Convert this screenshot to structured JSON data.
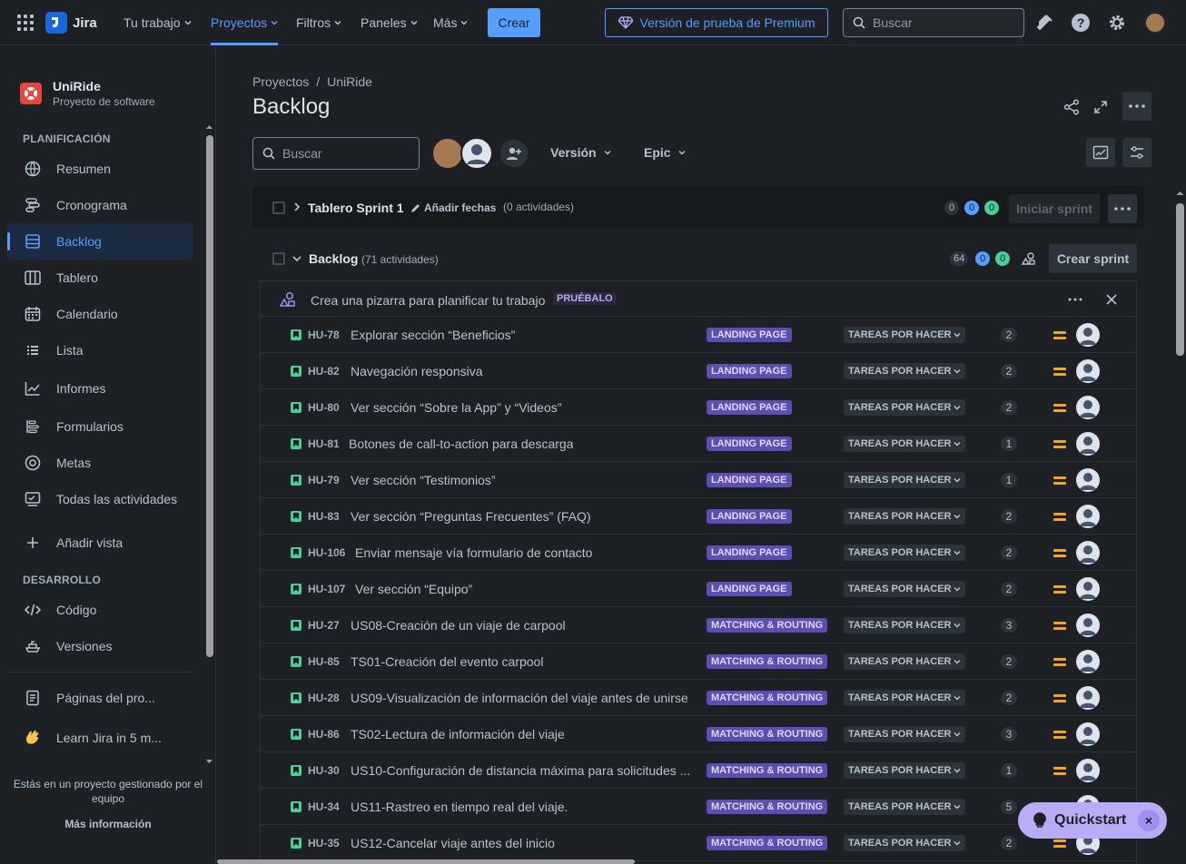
{
  "topnav": {
    "app_name": "Jira",
    "items": [
      "Tu trabajo",
      "Proyectos",
      "Filtros",
      "Paneles",
      "Más"
    ],
    "create_label": "Crear",
    "premium_label": "Versión de prueba de Premium",
    "search_placeholder": "Buscar"
  },
  "sidebar": {
    "project_name": "UniRide",
    "project_type": "Proyecto de software",
    "planning_heading": "PLANIFICACIÓN",
    "planning_items": [
      "Resumen",
      "Cronograma",
      "Backlog",
      "Tablero",
      "Calendario",
      "Lista",
      "Informes",
      "Formularios",
      "Metas",
      "Todas las actividades"
    ],
    "add_view": "Añadir vista",
    "dev_heading": "DESARROLLO",
    "dev_items": [
      "Código",
      "Versiones"
    ],
    "bottom_items": [
      "Páginas del pro...",
      "Learn Jira in 5 m..."
    ],
    "footer_text": "Estás en un proyecto gestionado por el equipo",
    "footer_link": "Más información"
  },
  "main": {
    "breadcrumb": [
      "Proyectos",
      "UniRide"
    ],
    "title": "Backlog",
    "search_placeholder": "Buscar",
    "filters": [
      "Versión",
      "Epic"
    ],
    "sprint": {
      "name": "Tablero Sprint 1",
      "add_dates": "Añadir fechas",
      "count": "(0 actividades)",
      "pills": [
        "0",
        "0",
        "0"
      ],
      "start_label": "Iniciar sprint"
    },
    "backlog": {
      "name": "Backlog",
      "count": "(71 actividades)",
      "pills": [
        "64",
        "0",
        "0"
      ],
      "create_sprint_label": "Crear sprint"
    },
    "promo": {
      "text": "Crea una pizarra para planificar tu trabajo",
      "badge": "PRUÉBALO"
    },
    "issues": [
      {
        "key": "HU-78",
        "summary": "Explorar sección “Beneficios”",
        "epic": "LANDING PAGE",
        "status": "TAREAS POR HACER",
        "estimate": "2"
      },
      {
        "key": "HU-82",
        "summary": "Navegación responsiva",
        "epic": "LANDING PAGE",
        "status": "TAREAS POR HACER",
        "estimate": "2"
      },
      {
        "key": "HU-80",
        "summary": "Ver sección “Sobre la App” y “Videos”",
        "epic": "LANDING PAGE",
        "status": "TAREAS POR HACER",
        "estimate": "2"
      },
      {
        "key": "HU-81",
        "summary": "Botones de call-to-action para descarga",
        "epic": "LANDING PAGE",
        "status": "TAREAS POR HACER",
        "estimate": "1"
      },
      {
        "key": "HU-79",
        "summary": "Ver sección “Testimonios”",
        "epic": "LANDING PAGE",
        "status": "TAREAS POR HACER",
        "estimate": "1"
      },
      {
        "key": "HU-83",
        "summary": "Ver sección “Preguntas Frecuentes” (FAQ)",
        "epic": "LANDING PAGE",
        "status": "TAREAS POR HACER",
        "estimate": "2"
      },
      {
        "key": "HU-106",
        "summary": "Enviar mensaje vía formulario de contacto",
        "epic": "LANDING PAGE",
        "status": "TAREAS POR HACER",
        "estimate": "2"
      },
      {
        "key": "HU-107",
        "summary": "Ver sección “Equipo”",
        "epic": "LANDING PAGE",
        "status": "TAREAS POR HACER",
        "estimate": "2"
      },
      {
        "key": "HU-27",
        "summary": "US08-Creación de un viaje de carpool",
        "epic": "MATCHING & ROUTING",
        "status": "TAREAS POR HACER",
        "estimate": "3"
      },
      {
        "key": "HU-85",
        "summary": "TS01-Creación del evento carpool",
        "epic": "MATCHING & ROUTING",
        "status": "TAREAS POR HACER",
        "estimate": "2"
      },
      {
        "key": "HU-28",
        "summary": "US09-Visualización de información del viaje antes de unirse",
        "epic": "MATCHING & ROUTING",
        "status": "TAREAS POR HACER",
        "estimate": "2"
      },
      {
        "key": "HU-86",
        "summary": "TS02-Lectura de información del viaje",
        "epic": "MATCHING & ROUTING",
        "status": "TAREAS POR HACER",
        "estimate": "3"
      },
      {
        "key": "HU-30",
        "summary": "US10-Configuración de distancia máxima para solicitudes ...",
        "epic": "MATCHING & ROUTING",
        "status": "TAREAS POR HACER",
        "estimate": "1"
      },
      {
        "key": "HU-34",
        "summary": "US11-Rastreo en tiempo real del viaje.",
        "epic": "MATCHING & ROUTING",
        "status": "TAREAS POR HACER",
        "estimate": "5"
      },
      {
        "key": "HU-35",
        "summary": "US12-Cancelar viaje antes del inicio",
        "epic": "MATCHING & ROUTING",
        "status": "TAREAS POR HACER",
        "estimate": "2"
      }
    ]
  },
  "quickstart": {
    "label": "Quickstart",
    "close": "×"
  },
  "colors": {
    "accent": "#579dff",
    "epic": "#5e4db2",
    "story": "#4bce97",
    "priority": "#f5a524",
    "quickstart": "#b8acf6"
  }
}
